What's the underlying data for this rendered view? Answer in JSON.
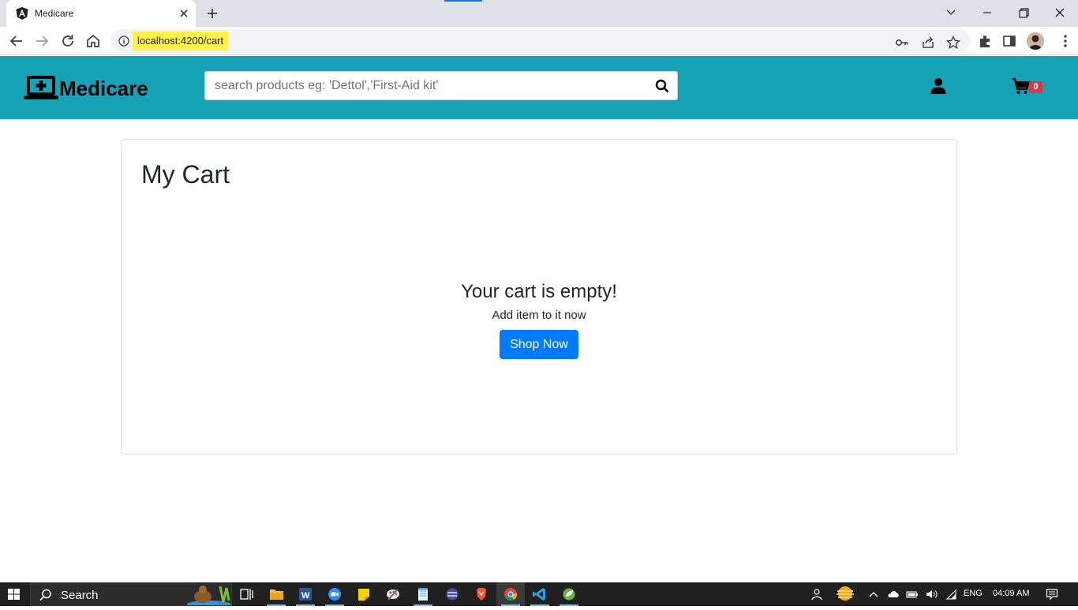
{
  "browser": {
    "tab_title": "Medicare",
    "url": "localhost:4200/cart"
  },
  "navbar": {
    "brand": "Medicare",
    "search_placeholder": "search products eg: 'Dettol','First-Aid kit'",
    "cart_count": "0",
    "color": "#17a2b8"
  },
  "cart": {
    "title": "My Cart",
    "empty_title": "Your cart is empty!",
    "empty_subtitle": "Add item to it now",
    "shop_button": "Shop Now"
  },
  "taskbar": {
    "search_label": "Search",
    "language": "ENG",
    "time": "04:09 AM"
  }
}
